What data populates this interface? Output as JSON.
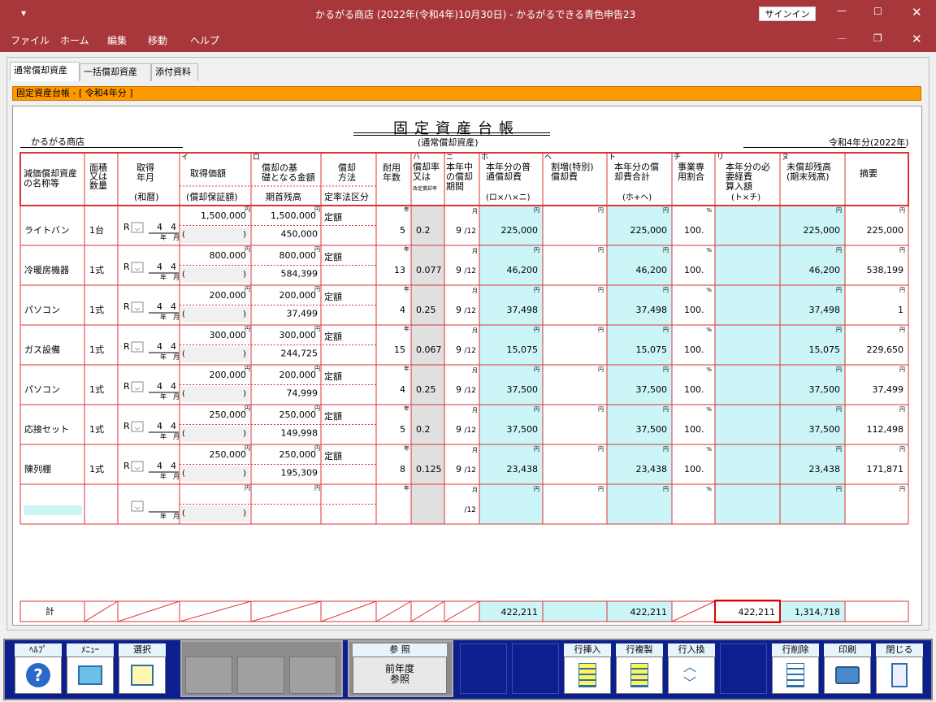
{
  "window": {
    "title": "かるがる商店 (2022年(令和4年)10月30日)  -  かるがるできる青色申告23",
    "signin_label": "サインイン"
  },
  "menu": [
    "ファイル",
    "ホーム",
    "編集",
    "移動",
    "ヘルプ"
  ],
  "tabs": [
    {
      "label": "通常償却資産",
      "active": true
    },
    {
      "label": "一括償却資産",
      "active": false
    },
    {
      "label": "添付資料",
      "active": false
    }
  ],
  "banner": "固定資産台帳 - [ 令和4年分 ]",
  "ledger": {
    "title": "固定資産台帳",
    "subtitle": "(通常償却資産)",
    "company": "かるがる商店",
    "year": "令和4年分(2022年)",
    "headers": {
      "name": "減価償却資産の名称等",
      "qty": "面積又は数量",
      "acq_date": "取得年月",
      "acq_era": "(和暦)",
      "i_mark": "イ",
      "acq_price": "取得価額",
      "acq_guarantee": "(償却保証額)",
      "ro_mark": "ロ",
      "base": "償却の基礎となる金額",
      "opening": "期首残高",
      "method": "償却方法",
      "method_sub": "定率法区分",
      "life": "耐用年数",
      "ha_mark": "ハ",
      "rate": "償却率又は",
      "rate_sub": "改定償却率",
      "ni_mark": "ニ",
      "months": "本年中の償却期間",
      "ho_mark": "ホ",
      "normal_dep": "本年分の普通償却費",
      "normal_dep_sub": "(ロ×ハ×ニ)",
      "he_mark": "ヘ",
      "special_dep": "割増(特別)償却費",
      "to_mark": "ト",
      "total_dep": "本年分の償却費合計",
      "total_dep_sub": "(ホ+ヘ)",
      "chi_mark": "チ",
      "business_ratio": "事業専用割合",
      "ri_mark": "リ",
      "expense": "本年分の必要経費算入額",
      "expense_sub": "(ト×チ)",
      "nu_mark": "ヌ",
      "unamortized": "未償却残高(期末残高)",
      "remarks": "摘要"
    },
    "units": {
      "yen": "円",
      "year": "年",
      "month": "月",
      "percent": "%",
      "per12": "/12",
      "era": "R"
    },
    "rows": [
      {
        "name": "ライトバン",
        "qty": "1台",
        "era": "R",
        "y": "4",
        "m": "4",
        "acq": "1,500,000",
        "base": "1,500,000",
        "opening": "450,000",
        "method": "定額",
        "life": "5",
        "rate": "0.2",
        "months": "9",
        "normal": "225,000",
        "special": "",
        "total": "225,000",
        "ratio": "100.",
        "expense": "225,000",
        "unamort": "225,000"
      },
      {
        "name": "冷暖房機器",
        "qty": "1式",
        "era": "R",
        "y": "4",
        "m": "4",
        "acq": "800,000",
        "base": "800,000",
        "opening": "584,399",
        "method": "定額",
        "life": "13",
        "rate": "0.077",
        "months": "9",
        "normal": "46,200",
        "special": "",
        "total": "46,200",
        "ratio": "100.",
        "expense": "46,200",
        "unamort": "538,199"
      },
      {
        "name": "パソコン",
        "qty": "1式",
        "era": "R",
        "y": "4",
        "m": "4",
        "acq": "200,000",
        "base": "200,000",
        "opening": "37,499",
        "method": "定額",
        "life": "4",
        "rate": "0.25",
        "months": "9",
        "normal": "37,498",
        "special": "",
        "total": "37,498",
        "ratio": "100.",
        "expense": "37,498",
        "unamort": "1"
      },
      {
        "name": "ガス設備",
        "qty": "1式",
        "era": "R",
        "y": "4",
        "m": "4",
        "acq": "300,000",
        "base": "300,000",
        "opening": "244,725",
        "method": "定額",
        "life": "15",
        "rate": "0.067",
        "months": "9",
        "normal": "15,075",
        "special": "",
        "total": "15,075",
        "ratio": "100.",
        "expense": "15,075",
        "unamort": "229,650"
      },
      {
        "name": "パソコン",
        "qty": "1式",
        "era": "R",
        "y": "4",
        "m": "4",
        "acq": "200,000",
        "base": "200,000",
        "opening": "74,999",
        "method": "定額",
        "life": "4",
        "rate": "0.25",
        "months": "9",
        "normal": "37,500",
        "special": "",
        "total": "37,500",
        "ratio": "100.",
        "expense": "37,500",
        "unamort": "37,499"
      },
      {
        "name": "応接セット",
        "qty": "1式",
        "era": "R",
        "y": "4",
        "m": "4",
        "acq": "250,000",
        "base": "250,000",
        "opening": "149,998",
        "method": "定額",
        "life": "5",
        "rate": "0.2",
        "months": "9",
        "normal": "37,500",
        "special": "",
        "total": "37,500",
        "ratio": "100.",
        "expense": "37,500",
        "unamort": "112,498"
      },
      {
        "name": "陳列棚",
        "qty": "1式",
        "era": "R",
        "y": "4",
        "m": "4",
        "acq": "250,000",
        "base": "250,000",
        "opening": "195,309",
        "method": "定額",
        "life": "8",
        "rate": "0.125",
        "months": "9",
        "normal": "23,438",
        "special": "",
        "total": "23,438",
        "ratio": "100.",
        "expense": "23,438",
        "unamort": "171,871"
      },
      {
        "name": "",
        "qty": "",
        "era": "",
        "y": "",
        "m": "",
        "acq": "",
        "base": "",
        "opening": "",
        "method": "",
        "life": "",
        "rate": "",
        "months": "",
        "normal": "",
        "special": "",
        "total": "",
        "ratio": "",
        "expense": "",
        "unamort": ""
      }
    ],
    "totals": {
      "label": "計",
      "normal": "422,211",
      "special": "",
      "total": "422,211",
      "expense": "422,211",
      "unamort": "1,314,718"
    }
  },
  "toolbar": {
    "help": "ﾍﾙﾌﾟ",
    "menu": "ﾒﾆｭｰ",
    "select": "選択",
    "ref": "参 照",
    "prev_year": "前年度参照",
    "insert_row": "行挿入",
    "copy_row": "行複製",
    "swap_row": "行入換",
    "delete_row": "行削除",
    "print": "印刷",
    "close": "閉じる"
  },
  "icons": [
    "menu-caret-icon",
    "minimize-icon",
    "maximize-icon",
    "close-icon",
    "restore-icon",
    "help-icon",
    "calculator-icon",
    "table-icon",
    "insert-row-icon",
    "copy-row-icon",
    "swap-row-icon",
    "delete-row-icon",
    "printer-icon",
    "exit-icon"
  ],
  "colors": {
    "titlebar": "#a8373b",
    "highlight": "#ff9900",
    "cell_cyan": "#ccf5f8",
    "grid_red": "#dd3333",
    "toolbar_blue": "#0d1f8e"
  }
}
